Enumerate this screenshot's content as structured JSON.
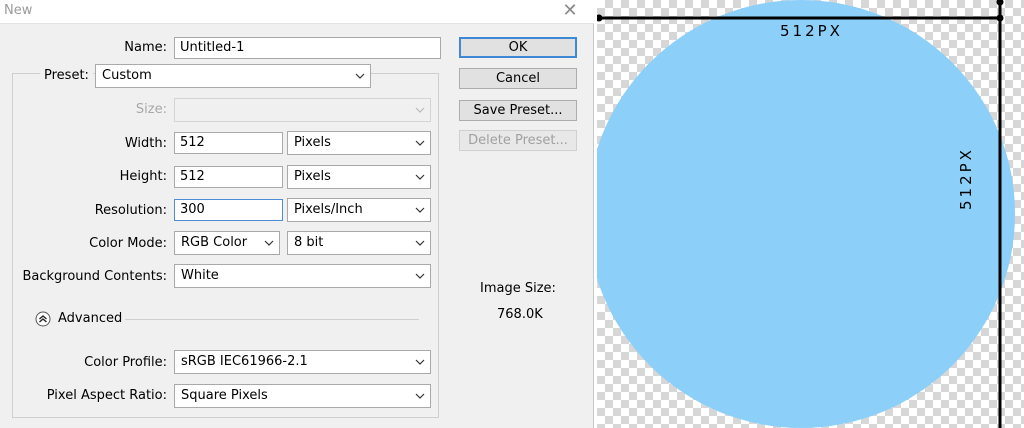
{
  "dialog": {
    "title": "New",
    "name_label": "Name:",
    "name_value": "Untitled-1",
    "preset_label": "Preset:",
    "preset_value": "Custom",
    "size_label": "Size:",
    "size_value": "",
    "width_label": "Width:",
    "width_value": "512",
    "width_unit": "Pixels",
    "height_label": "Height:",
    "height_value": "512",
    "height_unit": "Pixels",
    "resolution_label": "Resolution:",
    "resolution_value": "300",
    "resolution_unit": "Pixels/Inch",
    "color_mode_label": "Color Mode:",
    "color_mode_value": "RGB Color",
    "bit_depth_value": "8 bit",
    "background_label": "Background Contents:",
    "background_value": "White",
    "advanced_label": "Advanced",
    "color_profile_label": "Color Profile:",
    "color_profile_value": "sRGB IEC61966-2.1",
    "pixel_aspect_label": "Pixel Aspect Ratio:",
    "pixel_aspect_value": "Square Pixels",
    "image_size_label": "Image Size:",
    "image_size_value": "768.0K",
    "buttons": {
      "ok": "OK",
      "cancel": "Cancel",
      "save_preset": "Save Preset...",
      "delete_preset": "Delete Preset..."
    }
  },
  "preview": {
    "width_annotation": "512PX",
    "height_annotation": "512PX",
    "circle_color": "#8ccff8",
    "line_color": "#000000"
  }
}
